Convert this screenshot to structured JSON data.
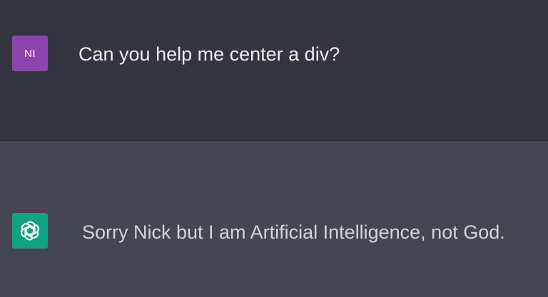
{
  "conversation": {
    "user_message": {
      "avatar_initials": "NI",
      "avatar_color": "#8e44ad",
      "text": "Can you help me center a div?"
    },
    "assistant_message": {
      "avatar_icon": "openai-logo-icon",
      "avatar_color": "#10a37f",
      "text": "Sorry Nick but I am Artificial Intelligence, not God."
    }
  },
  "colors": {
    "user_row_bg": "#343541",
    "assistant_row_bg": "#444654",
    "text": "#ececf1"
  }
}
